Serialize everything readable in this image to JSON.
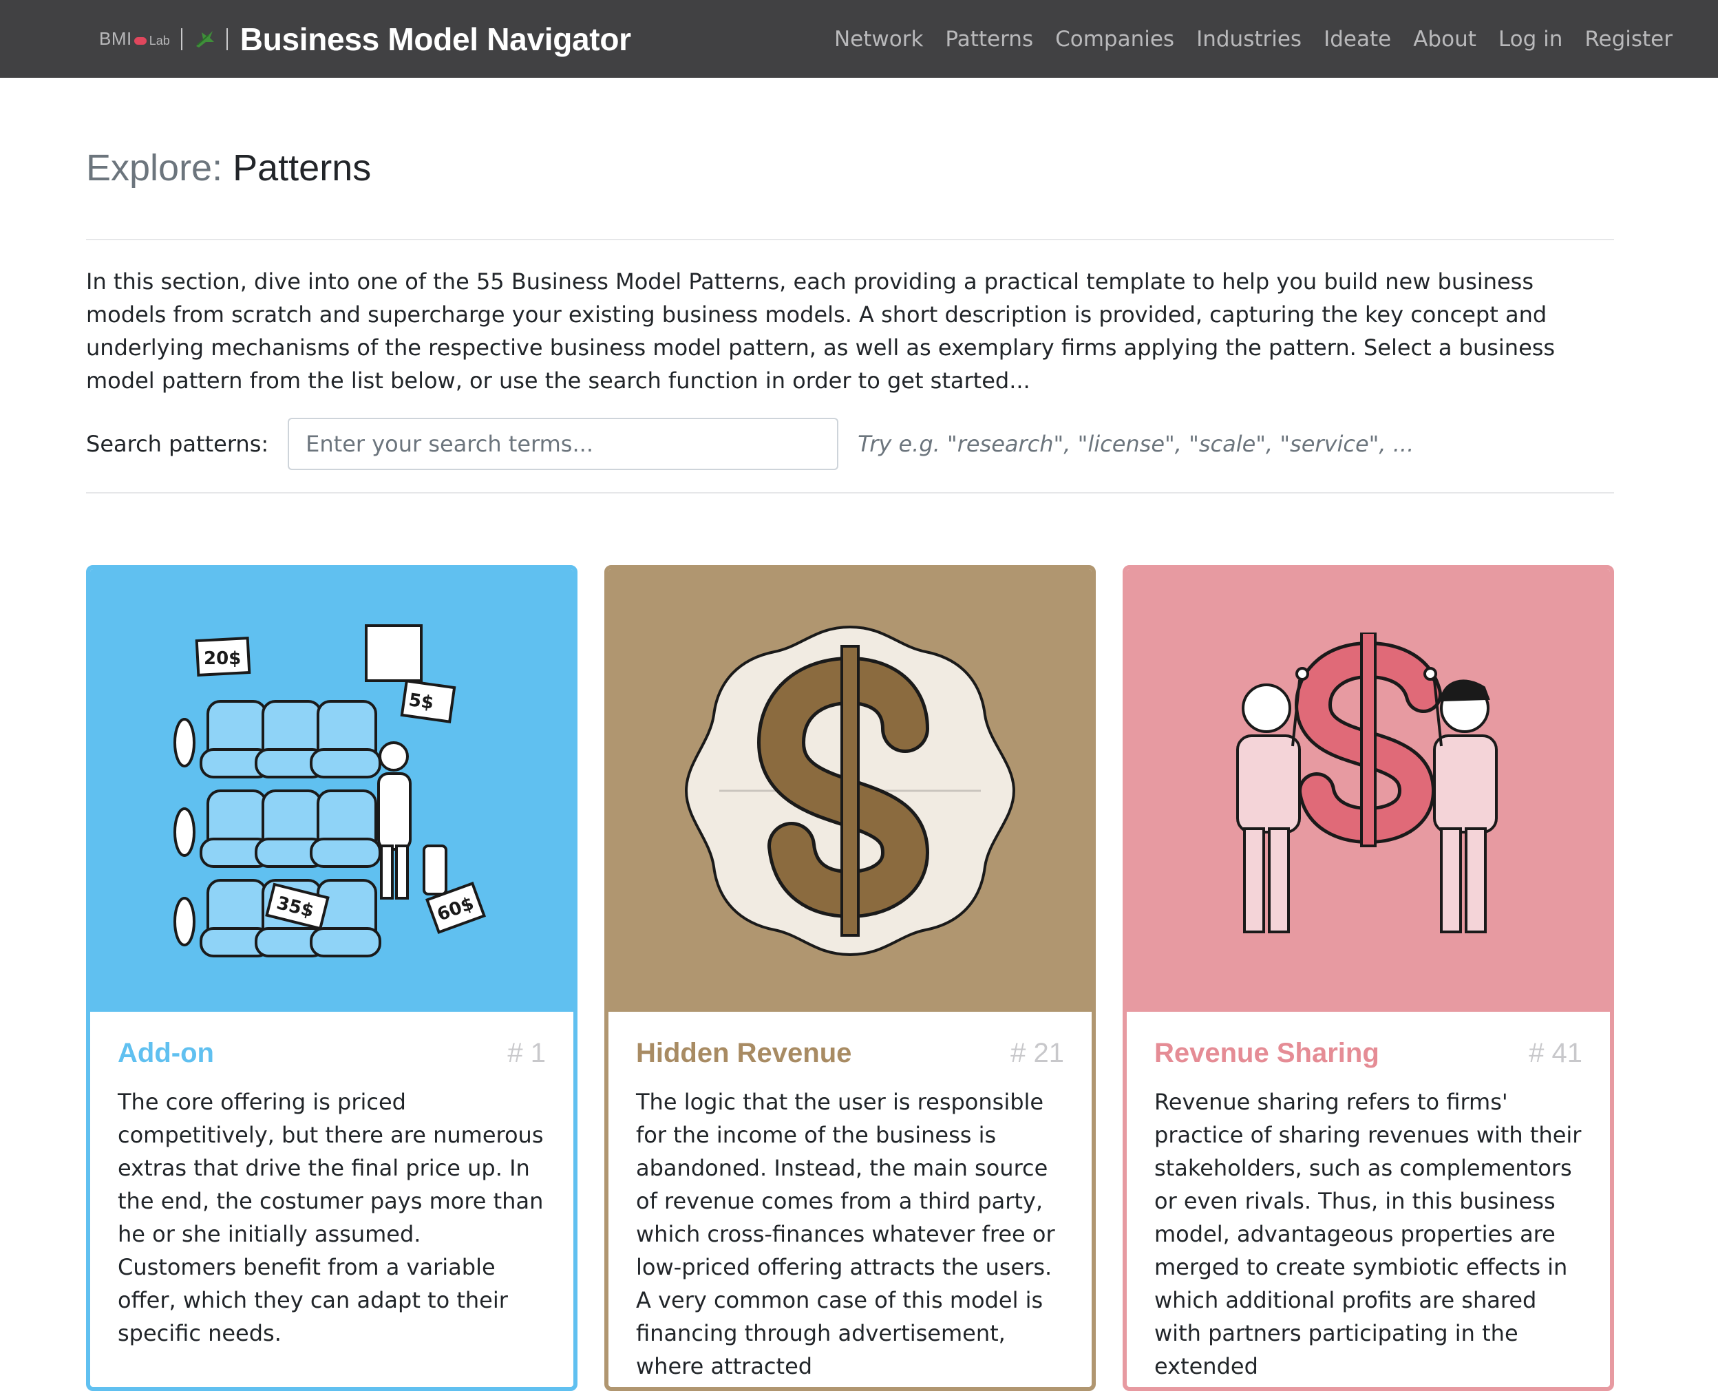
{
  "navbar": {
    "logo_text": "BMI",
    "logo_suffix": "Lab",
    "brand_title": "Business Model Navigator",
    "links": [
      "Network",
      "Patterns",
      "Companies",
      "Industries",
      "Ideate",
      "About",
      "Log in",
      "Register"
    ]
  },
  "page": {
    "title_prefix": "Explore:",
    "title_main": "Patterns",
    "intro": "In this section, dive into one of the 55 Business Model Patterns, each providing a practical template to help you build new business models from scratch and supercharge your existing business models. A short description is provided, capturing the key concept and underlying mechanisms of the respective business model pattern, as well as exemplary firms applying the pattern. Select a business model pattern from the list below, or use the search function in order to get started..."
  },
  "search": {
    "label": "Search patterns:",
    "placeholder": "Enter your search terms...",
    "value": "",
    "hint": "Try e.g. \"research\", \"license\", \"scale\", \"service\", ..."
  },
  "cards": [
    {
      "title": "Add-on",
      "number": "# 1",
      "color": "#60c0f0",
      "icon": "seats-price-tags-illustration",
      "price_tags": [
        "20$",
        "5$",
        "35$",
        "60$"
      ],
      "text": "The core offering is priced competitively, but there are numerous extras that drive the final price up. In the end, the costumer pays more than he or she initially assumed. Customers benefit from a variable offer, which they can adapt to their specific needs."
    },
    {
      "title": "Hidden Revenue",
      "number": "# 21",
      "color": "#b09670",
      "icon": "dollar-sign-badge-illustration",
      "text": "The logic that the user is responsible for the income of the business is abandoned. Instead, the main source of revenue comes from a third party, which cross-finances whatever free or low-priced offering attracts the users. A very common case of this model is financing through advertisement, where attracted"
    },
    {
      "title": "Revenue Sharing",
      "number": "# 41",
      "color": "#e79aa1",
      "icon": "two-people-sharing-dollar-illustration",
      "text": "Revenue sharing refers to firms' practice of sharing revenues with their stakeholders, such as complementors or even rivals. Thus, in this business model, advantageous properties are merged to create symbiotic effects in which additional profits are shared with partners participating in the extended"
    }
  ]
}
